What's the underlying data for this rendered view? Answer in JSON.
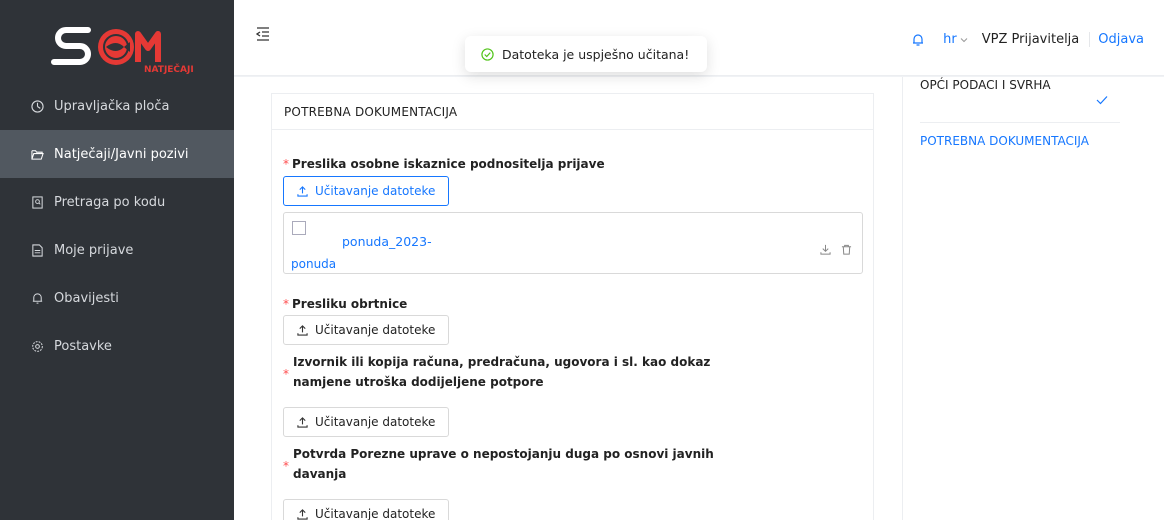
{
  "sidebar": {
    "logo_text": "NATJEČAJI",
    "items": [
      {
        "label": "Upravljačka ploča",
        "icon": "dashboard-icon"
      },
      {
        "label": "Natječaji/Javni pozivi",
        "icon": "folder-open-icon"
      },
      {
        "label": "Pretraga po kodu",
        "icon": "search-file-icon"
      },
      {
        "label": "Moje prijave",
        "icon": "file-text-icon"
      },
      {
        "label": "Obavijesti",
        "icon": "bell-icon"
      },
      {
        "label": "Postavke",
        "icon": "settings-icon"
      }
    ]
  },
  "header": {
    "lang": "hr",
    "username": "VPZ Prijavitelja",
    "logout": "Odjava"
  },
  "toast": {
    "message": "Datoteka je uspješno učitana!"
  },
  "panel": {
    "title": "POTREBNA DOKUMENTACIJA",
    "upload_label": "Učitavanje datoteke",
    "fields": [
      {
        "label": "Preslika osobne iskaznice podnositelja prijave"
      },
      {
        "label": "Presliku obrtnice"
      },
      {
        "label": "Izvornik ili kopija računa, predračuna, ugovora i sl. kao dokaz namjene utroška dodijeljene potpore"
      },
      {
        "label": "Potvrda Porezne uprave o nepostojanju duga po osnovi javnih davanja"
      }
    ],
    "uploaded_file": {
      "name": "ponuda_2023-",
      "thumb_text": "ponuda"
    }
  },
  "steps": [
    {
      "label": "OPĆI PODACI I SVRHA"
    },
    {
      "label": "POTREBNA DOKUMENTACIJA"
    }
  ],
  "colors": {
    "accent": "#1677ff",
    "sidebar_bg": "#2f3338",
    "sidebar_active": "#515860",
    "required": "#ff4d4f",
    "logo_red": "#e53935"
  }
}
